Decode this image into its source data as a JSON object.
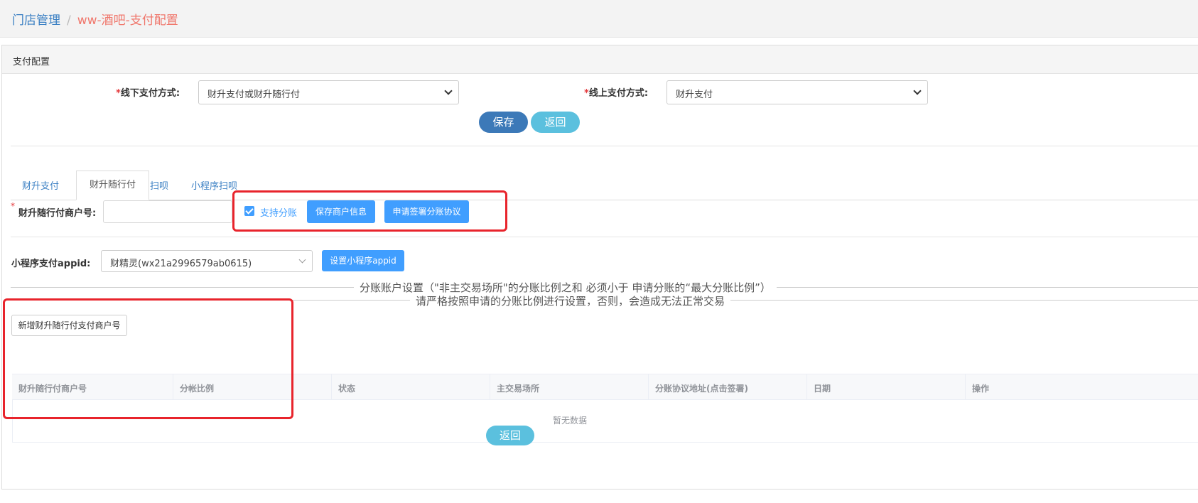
{
  "breadcrumb": {
    "parent": "门店管理",
    "separator": "/",
    "current": "ww-酒吧-支付配置"
  },
  "panel": {
    "title": "支付配置"
  },
  "form": {
    "offline": {
      "required_mark": "*",
      "label": "线下支付方式:",
      "value": "财升支付或财升随行付"
    },
    "online": {
      "required_mark": "*",
      "label": "线上支付方式:",
      "value": "财升支付"
    },
    "save_label": "保存",
    "back_label": "返回"
  },
  "tabs": [
    {
      "label": "财升支付",
      "active": false
    },
    {
      "label": "财升随行付",
      "active": true
    },
    {
      "label": "扫呗",
      "active": false
    },
    {
      "label": "小程序扫呗",
      "active": false
    }
  ],
  "merchant": {
    "required_mark": "*",
    "label": "财升随行付商户号:",
    "value": "",
    "split_checkbox": {
      "label": "支持分账",
      "checked": true
    },
    "save_info_label": "保存商户信息",
    "apply_label": "申请签署分账协议"
  },
  "miniapp": {
    "label": "小程序支付appid:",
    "value": "财精灵(wx21a2996579ab0615)",
    "set_label": "设置小程序appid"
  },
  "split_settings": {
    "line1": "分账账户设置（\"非主交易场所\"的分账比例之和 必须小于 申请分账的“最大分账比例”）",
    "line2": "请严格按照申请的分账比例进行设置，否则，会造成无法正常交易"
  },
  "add_button_label": "新增财升随行付支付商户号",
  "table": {
    "columns": [
      "财升随行付商户号",
      "分帐比例",
      "状态",
      "主交易场所",
      "分账协议地址(点击签署)",
      "日期",
      "操作"
    ],
    "rows": [],
    "empty_text": "暂无数据"
  },
  "footer": {
    "back_label": "返回"
  },
  "colors": {
    "primary": "#3c79b8",
    "info": "#5bc0de",
    "accent": "#409eff",
    "highlight": "#e8242c"
  }
}
